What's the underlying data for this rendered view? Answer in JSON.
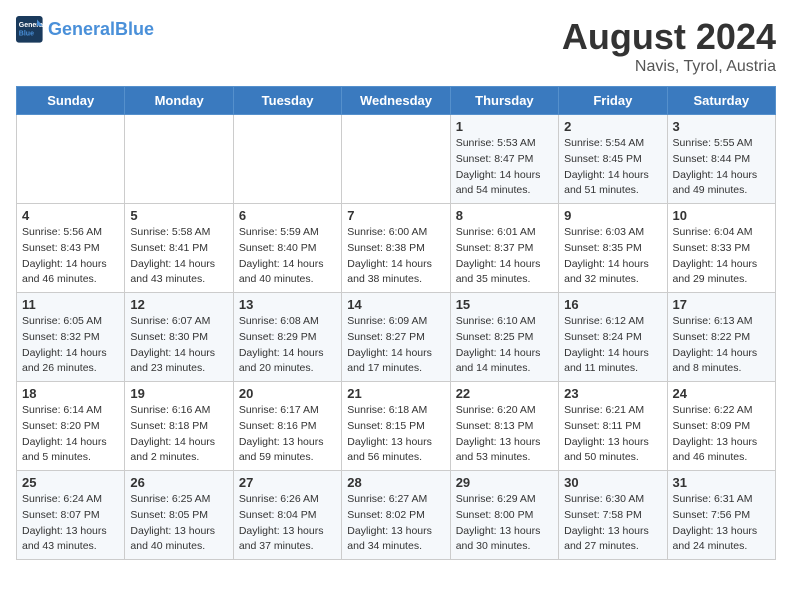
{
  "header": {
    "logo_general": "General",
    "logo_blue": "Blue",
    "main_title": "August 2024",
    "subtitle": "Navis, Tyrol, Austria"
  },
  "days_of_week": [
    "Sunday",
    "Monday",
    "Tuesday",
    "Wednesday",
    "Thursday",
    "Friday",
    "Saturday"
  ],
  "weeks": [
    [
      {
        "day": "",
        "info": ""
      },
      {
        "day": "",
        "info": ""
      },
      {
        "day": "",
        "info": ""
      },
      {
        "day": "",
        "info": ""
      },
      {
        "day": "1",
        "info": "Sunrise: 5:53 AM\nSunset: 8:47 PM\nDaylight: 14 hours\nand 54 minutes."
      },
      {
        "day": "2",
        "info": "Sunrise: 5:54 AM\nSunset: 8:45 PM\nDaylight: 14 hours\nand 51 minutes."
      },
      {
        "day": "3",
        "info": "Sunrise: 5:55 AM\nSunset: 8:44 PM\nDaylight: 14 hours\nand 49 minutes."
      }
    ],
    [
      {
        "day": "4",
        "info": "Sunrise: 5:56 AM\nSunset: 8:43 PM\nDaylight: 14 hours\nand 46 minutes."
      },
      {
        "day": "5",
        "info": "Sunrise: 5:58 AM\nSunset: 8:41 PM\nDaylight: 14 hours\nand 43 minutes."
      },
      {
        "day": "6",
        "info": "Sunrise: 5:59 AM\nSunset: 8:40 PM\nDaylight: 14 hours\nand 40 minutes."
      },
      {
        "day": "7",
        "info": "Sunrise: 6:00 AM\nSunset: 8:38 PM\nDaylight: 14 hours\nand 38 minutes."
      },
      {
        "day": "8",
        "info": "Sunrise: 6:01 AM\nSunset: 8:37 PM\nDaylight: 14 hours\nand 35 minutes."
      },
      {
        "day": "9",
        "info": "Sunrise: 6:03 AM\nSunset: 8:35 PM\nDaylight: 14 hours\nand 32 minutes."
      },
      {
        "day": "10",
        "info": "Sunrise: 6:04 AM\nSunset: 8:33 PM\nDaylight: 14 hours\nand 29 minutes."
      }
    ],
    [
      {
        "day": "11",
        "info": "Sunrise: 6:05 AM\nSunset: 8:32 PM\nDaylight: 14 hours\nand 26 minutes."
      },
      {
        "day": "12",
        "info": "Sunrise: 6:07 AM\nSunset: 8:30 PM\nDaylight: 14 hours\nand 23 minutes."
      },
      {
        "day": "13",
        "info": "Sunrise: 6:08 AM\nSunset: 8:29 PM\nDaylight: 14 hours\nand 20 minutes."
      },
      {
        "day": "14",
        "info": "Sunrise: 6:09 AM\nSunset: 8:27 PM\nDaylight: 14 hours\nand 17 minutes."
      },
      {
        "day": "15",
        "info": "Sunrise: 6:10 AM\nSunset: 8:25 PM\nDaylight: 14 hours\nand 14 minutes."
      },
      {
        "day": "16",
        "info": "Sunrise: 6:12 AM\nSunset: 8:24 PM\nDaylight: 14 hours\nand 11 minutes."
      },
      {
        "day": "17",
        "info": "Sunrise: 6:13 AM\nSunset: 8:22 PM\nDaylight: 14 hours\nand 8 minutes."
      }
    ],
    [
      {
        "day": "18",
        "info": "Sunrise: 6:14 AM\nSunset: 8:20 PM\nDaylight: 14 hours\nand 5 minutes."
      },
      {
        "day": "19",
        "info": "Sunrise: 6:16 AM\nSunset: 8:18 PM\nDaylight: 14 hours\nand 2 minutes."
      },
      {
        "day": "20",
        "info": "Sunrise: 6:17 AM\nSunset: 8:16 PM\nDaylight: 13 hours\nand 59 minutes."
      },
      {
        "day": "21",
        "info": "Sunrise: 6:18 AM\nSunset: 8:15 PM\nDaylight: 13 hours\nand 56 minutes."
      },
      {
        "day": "22",
        "info": "Sunrise: 6:20 AM\nSunset: 8:13 PM\nDaylight: 13 hours\nand 53 minutes."
      },
      {
        "day": "23",
        "info": "Sunrise: 6:21 AM\nSunset: 8:11 PM\nDaylight: 13 hours\nand 50 minutes."
      },
      {
        "day": "24",
        "info": "Sunrise: 6:22 AM\nSunset: 8:09 PM\nDaylight: 13 hours\nand 46 minutes."
      }
    ],
    [
      {
        "day": "25",
        "info": "Sunrise: 6:24 AM\nSunset: 8:07 PM\nDaylight: 13 hours\nand 43 minutes."
      },
      {
        "day": "26",
        "info": "Sunrise: 6:25 AM\nSunset: 8:05 PM\nDaylight: 13 hours\nand 40 minutes."
      },
      {
        "day": "27",
        "info": "Sunrise: 6:26 AM\nSunset: 8:04 PM\nDaylight: 13 hours\nand 37 minutes."
      },
      {
        "day": "28",
        "info": "Sunrise: 6:27 AM\nSunset: 8:02 PM\nDaylight: 13 hours\nand 34 minutes."
      },
      {
        "day": "29",
        "info": "Sunrise: 6:29 AM\nSunset: 8:00 PM\nDaylight: 13 hours\nand 30 minutes."
      },
      {
        "day": "30",
        "info": "Sunrise: 6:30 AM\nSunset: 7:58 PM\nDaylight: 13 hours\nand 27 minutes."
      },
      {
        "day": "31",
        "info": "Sunrise: 6:31 AM\nSunset: 7:56 PM\nDaylight: 13 hours\nand 24 minutes."
      }
    ]
  ]
}
